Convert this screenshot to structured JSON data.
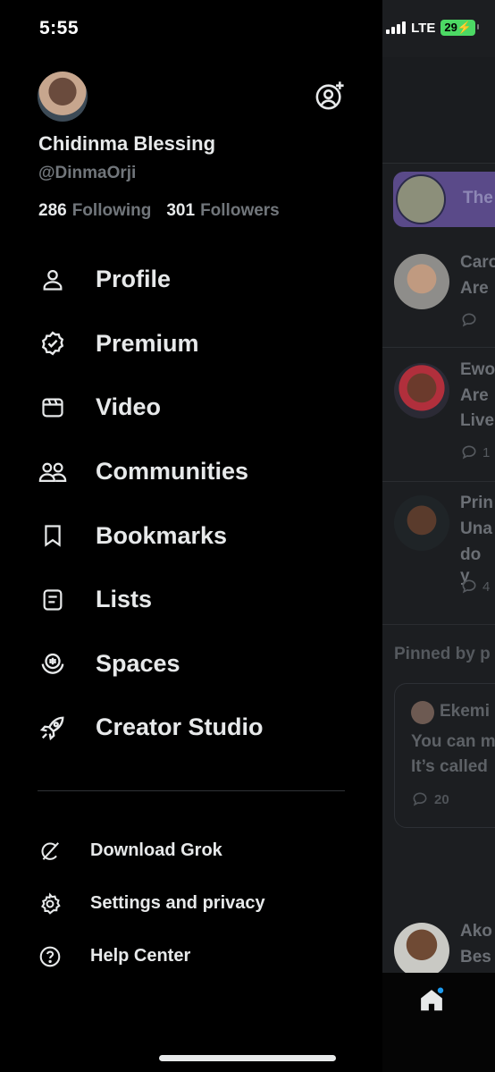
{
  "status_bar": {
    "time": "5:55",
    "network": "LTE",
    "battery": "29"
  },
  "profile": {
    "name": "Chidinma Blessing",
    "handle": "@DinmaOrji",
    "following_count": "286",
    "following_label": "Following",
    "followers_count": "301",
    "followers_label": "Followers"
  },
  "menu": [
    {
      "label": "Profile",
      "icon": "person-icon"
    },
    {
      "label": "Premium",
      "icon": "verified-badge-icon"
    },
    {
      "label": "Video",
      "icon": "video-icon"
    },
    {
      "label": "Communities",
      "icon": "communities-icon"
    },
    {
      "label": "Bookmarks",
      "icon": "bookmark-icon"
    },
    {
      "label": "Lists",
      "icon": "list-icon"
    },
    {
      "label": "Spaces",
      "icon": "spaces-icon"
    },
    {
      "label": "Creator Studio",
      "icon": "rocket-icon"
    }
  ],
  "secondary_menu": [
    {
      "label": "Download Grok",
      "icon": "grok-icon"
    },
    {
      "label": "Settings and privacy",
      "icon": "gear-icon"
    },
    {
      "label": "Help Center",
      "icon": "help-icon"
    }
  ],
  "feed_preview": {
    "space_text": "The",
    "posts": [
      {
        "line1": "Caro",
        "line2": "Are",
        "count": ""
      },
      {
        "line1": "Ewo",
        "line2": "Are",
        "line3": "Live",
        "count": "1"
      },
      {
        "line1": "Prin",
        "line2": "Una",
        "line3": "do y",
        "count": "4"
      }
    ],
    "pinned_label": "Pinned by p",
    "pinned_author": "Ekemi",
    "pinned_line1": "You can m",
    "pinned_line2": "It’s called",
    "pinned_count": "20"
  },
  "colors": {
    "background": "#000000",
    "text": "#e7e9ea",
    "muted": "#71767b",
    "battery": "#4cd964"
  }
}
